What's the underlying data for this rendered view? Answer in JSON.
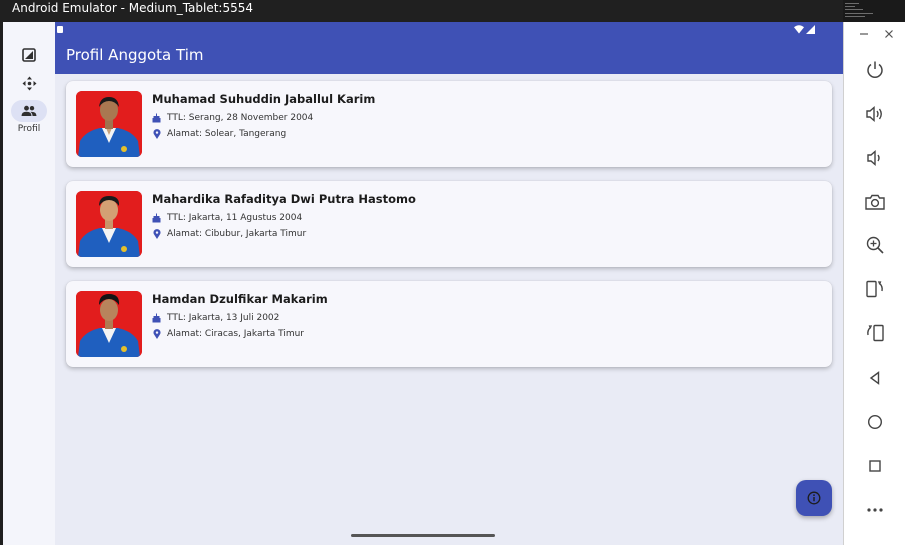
{
  "window": {
    "title": "Android Emulator - Medium_Tablet:5554"
  },
  "app_bar": {
    "title": "Profil Anggota Tim"
  },
  "nav_rail": {
    "items": [
      {
        "label": "",
        "icon": "image-icon",
        "active": false
      },
      {
        "label": "",
        "icon": "move-arrows-icon",
        "active": false
      },
      {
        "label": "Profil",
        "icon": "people-icon",
        "active": true
      }
    ]
  },
  "members": [
    {
      "name": "Muhamad Suhuddin Jaballul Karim",
      "ttl": "TTL: Serang, 28 November 2004",
      "address": "Alamat: Solear, Tangerang"
    },
    {
      "name": "Mahardika Rafaditya Dwi Putra Hastomo",
      "ttl": "TTL: Jakarta, 11 Agustus 2004",
      "address": "Alamat: Cibubur, Jakarta Timur"
    },
    {
      "name": "Hamdan Dzulfikar Makarim",
      "ttl": "TTL: Jakarta, 13 Juli 2002",
      "address": "Alamat: Ciracas, Jakarta Timur"
    }
  ],
  "fab": {
    "icon": "info-icon"
  },
  "emulator_toolbar": {
    "buttons": [
      "power-icon",
      "volume-up-icon",
      "volume-down-icon",
      "camera-icon",
      "zoom-in-icon",
      "rotate-left-icon",
      "rotate-right-icon",
      "back-icon",
      "home-icon",
      "overview-icon",
      "more-icon"
    ]
  },
  "colors": {
    "primary": "#3f51b5",
    "background": "#e9ebf5",
    "card": "#f7f7fc",
    "photo_background": "#e21d1d",
    "jacket": "#1f5fbf"
  }
}
